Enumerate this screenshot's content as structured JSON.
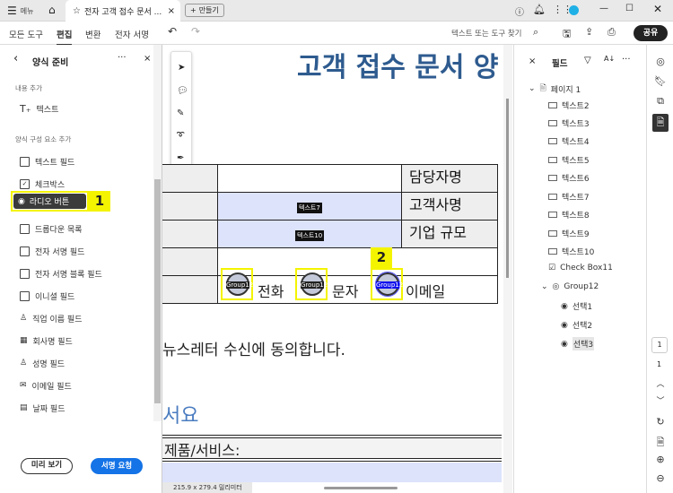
{
  "titlebar": {
    "menu": "메뉴",
    "tab_title": "전자 고객 접수 문서 ...",
    "create": "만들기"
  },
  "toolbar": {
    "tabs": [
      "모든 도구",
      "편집",
      "변환",
      "전자 서명"
    ],
    "active_tab": "편집",
    "search": "텍스트 또는 도구 찾기",
    "share": "공유"
  },
  "left_panel": {
    "title": "양식 준비",
    "section_content": "내용 추가",
    "text_item": "텍스트",
    "section_form": "양식 구성 요소 추가",
    "items": [
      "텍스트 필드",
      "체크박스",
      "라디오 버튼",
      "드롭다운 목록",
      "전자 서명 필드",
      "전자 서명 블록 필드",
      "이니셜 필드",
      "직업 이름 필드",
      "회사명 필드",
      "성명 필드",
      "이메일 필드",
      "날짜 필드"
    ],
    "preview": "미리 보기",
    "request_sign": "서명 요청",
    "callout1": "1"
  },
  "doc": {
    "title": "고객 접수 문서 양",
    "rows": [
      "담당자명",
      "고객사명",
      "기업 규모"
    ],
    "fields": [
      "텍스트7",
      "텍스트10"
    ],
    "radio_label": "Group12",
    "radio_options": [
      "전화",
      "문자",
      "이메일"
    ],
    "callout2": "2",
    "newsletter": "뉴스레터 수신에 동의합니다.",
    "heading2": "서요",
    "products": "제품/서비스:",
    "page_size": "215.9 x 279.4 밀리미터"
  },
  "fields_panel": {
    "title": "필드",
    "page": "페이지 1",
    "items": [
      "텍스트2",
      "텍스트3",
      "텍스트4",
      "텍스트5",
      "텍스트6",
      "텍스트7",
      "텍스트8",
      "텍스트9",
      "텍스트10"
    ],
    "checkbox": "Check Box11",
    "group": "Group12",
    "choices": [
      "선택1",
      "선택2",
      "선택3"
    ]
  },
  "rail": {
    "page_input": "1",
    "page_total": "1"
  }
}
